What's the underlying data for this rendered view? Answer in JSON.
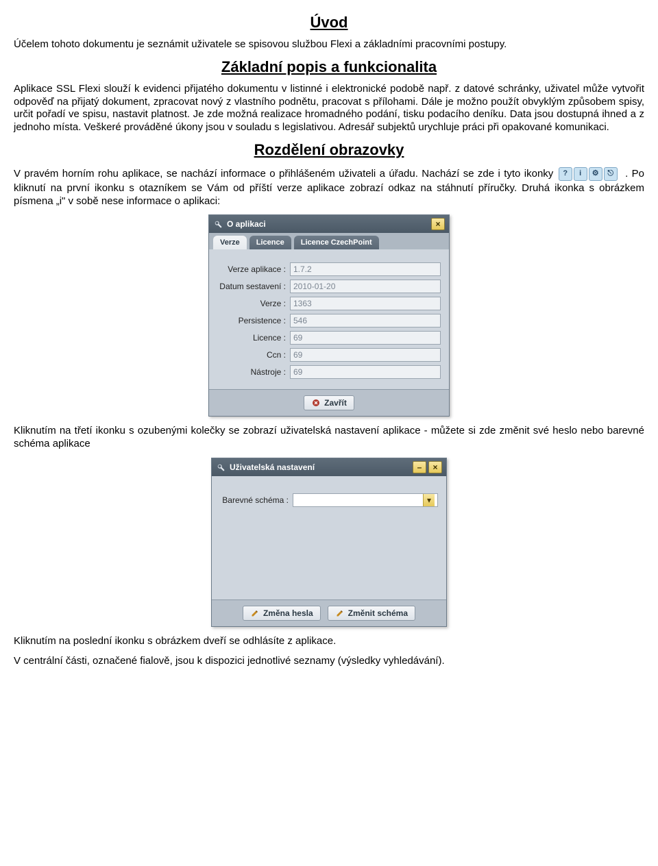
{
  "headings": {
    "uvod": "Úvod",
    "zakladni": "Základní popis a funkcionalita",
    "rozdeleni": "Rozdělení obrazovky"
  },
  "paragraphs": {
    "p1": "Účelem tohoto dokumentu je seznámit uživatele se spisovou službou Flexi a základními pracovními postupy.",
    "p2": "Aplikace SSL Flexi slouží k evidenci přijatého dokumentu v listinné i elektronické podobě např. z datové schránky, uživatel může vytvořit odpověď na přijatý dokument, zpracovat nový z vlastního podnětu, pracovat s přílohami. Dále je možno použít obvyklým způsobem spisy, určit pořadí ve spisu, nastavit platnost. Je zde možná realizace hromadného podání, tisku podacího deníku. Data jsou dostupná ihned a z jednoho místa. Veškeré prováděné úkony jsou v souladu s legislativou. Adresář subjektů urychluje práci při opakované komunikaci.",
    "p3a": "V pravém horním rohu aplikace, se nachází informace o přihlášeném uživateli a úřadu. Nachází se zde i tyto ikonky ",
    "p3b": ". Po kliknutí na první ikonku s otazníkem se Vám od příští verze aplikace zobrazí odkaz na stáhnutí příručky. Druhá ikonka s obrázkem písmena „i\" v sobě nese informace o aplikaci:",
    "p4": "Kliknutím na třetí ikonku s ozubenými kolečky se zobrazí uživatelská nastavení aplikace - můžete si zde změnit své heslo nebo barevné schéma aplikace",
    "p5": "Kliknutím na poslední ikonku s obrázkem dveří se odhlásíte z aplikace.",
    "p6": "V centrální části, označené fialově, jsou k dispozici jednotlivé seznamy (výsledky vyhledávání)."
  },
  "about_dialog": {
    "title": "O aplikaci",
    "tabs": [
      "Verze",
      "Licence",
      "Licence CzechPoint"
    ],
    "fields": [
      {
        "label": "Verze aplikace :",
        "value": "1.7.2"
      },
      {
        "label": "Datum sestavení :",
        "value": "2010-01-20"
      },
      {
        "label": "Verze :",
        "value": "1363"
      },
      {
        "label": "Persistence :",
        "value": "546"
      },
      {
        "label": "Licence :",
        "value": "69"
      },
      {
        "label": "Ccn :",
        "value": "69"
      },
      {
        "label": "Nástroje :",
        "value": "69"
      }
    ],
    "close_btn": "Zavřít"
  },
  "settings_dialog": {
    "title": "Uživatelská nastavení",
    "field_label": "Barevné schéma :",
    "field_value": "",
    "btn_change_pw": "Změna hesla",
    "btn_change_scheme": "Změnit schéma"
  }
}
